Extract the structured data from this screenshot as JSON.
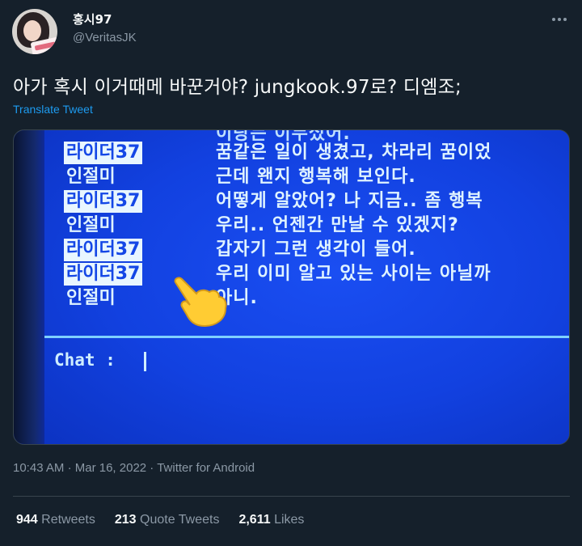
{
  "author": {
    "display_name": "홍시97",
    "handle": "@VeritasJK"
  },
  "tweet": {
    "text": "아가 혹시 이거때메 바꾼거야? jungkook.97로? 디엠조;",
    "translate_label": "Translate Tweet"
  },
  "media": {
    "partial_top_nick": "",
    "partial_top_msg": "이랑는 이누싰어.",
    "rows": [
      {
        "nick": "라이더37",
        "highlight": true,
        "msg": "꿈같은 일이 생겼고, 차라리 꿈이었"
      },
      {
        "nick": "인절미",
        "highlight": false,
        "msg": "근데 왠지 행복해 보인다."
      },
      {
        "nick": "라이더37",
        "highlight": true,
        "msg": "어떻게 알았어? 나 지금.. 좀 행복"
      },
      {
        "nick": "인절미",
        "highlight": false,
        "msg": "우리.. 언젠간 만날 수 있겠지?"
      },
      {
        "nick": "라이더37",
        "highlight": true,
        "msg": "갑자기 그런 생각이 들어."
      },
      {
        "nick": "라이더37",
        "highlight": true,
        "msg": "우리 이미 알고 있는 사이는 아닐까"
      },
      {
        "nick": "인절미",
        "highlight": false,
        "msg": "아니."
      }
    ],
    "chat_label": "Chat :",
    "colors": {
      "screen": "#1241e0",
      "highlight": "#e8f6ff",
      "text": "#dff3ff"
    }
  },
  "meta": {
    "time": "10:43 AM",
    "date": "Mar 16, 2022",
    "source": "Twitter for Android"
  },
  "stats": {
    "retweets_count": "944",
    "retweets_label": "Retweets",
    "quotes_count": "213",
    "quotes_label": "Quote Tweets",
    "likes_count": "2,611",
    "likes_label": "Likes"
  },
  "icons": [
    "more-icon",
    "pointing-hand-icon"
  ],
  "colors": {
    "background": "#15202b",
    "accent": "#1d9bf0",
    "muted": "#8b98a5"
  }
}
